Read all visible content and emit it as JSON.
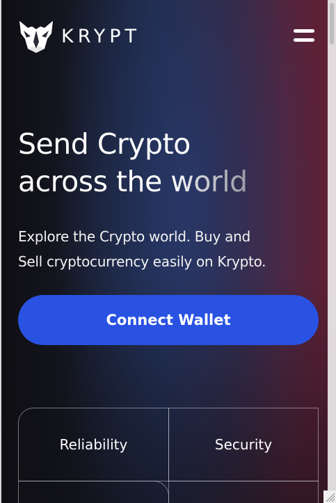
{
  "brand": {
    "logo_icon": "fox-icon",
    "name": "KRYPT"
  },
  "header": {
    "menu_icon": "hamburger-menu-icon"
  },
  "hero": {
    "title_line1": "Send Crypto",
    "title_line2_a": "across the ",
    "title_line2_b": "world",
    "subtitle_line1": "Explore the Crypto world. Buy and",
    "subtitle_line2": "Sell cryptocurrency easily on Krypto."
  },
  "actions": {
    "connect_label": "Connect Wallet"
  },
  "features": {
    "items": [
      {
        "label": "Reliability"
      },
      {
        "label": "Security"
      },
      {
        "label": ""
      },
      {
        "label": ""
      }
    ]
  },
  "colors": {
    "accent": "#2952e3",
    "background": "#0f0e13",
    "gradient_blue": "#1e2740",
    "gradient_red": "#5e2035"
  }
}
